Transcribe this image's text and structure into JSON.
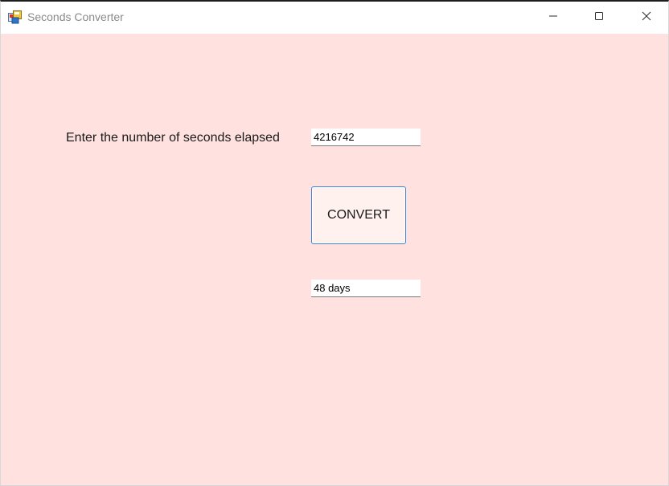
{
  "window": {
    "title": "Seconds Converter",
    "icon": "winforms-app-icon",
    "controls": {
      "minimize_icon": "minimize-icon",
      "maximize_icon": "maximize-icon",
      "close_icon": "close-icon"
    }
  },
  "form": {
    "background_color": "#ffe1df",
    "prompt_label": "Enter the number of seconds elapsed",
    "seconds_input": {
      "value": "4216742"
    },
    "convert_button": {
      "label": "CONVERT",
      "border_color": "#3b86d4"
    },
    "result_output": {
      "value": "48 days"
    }
  }
}
